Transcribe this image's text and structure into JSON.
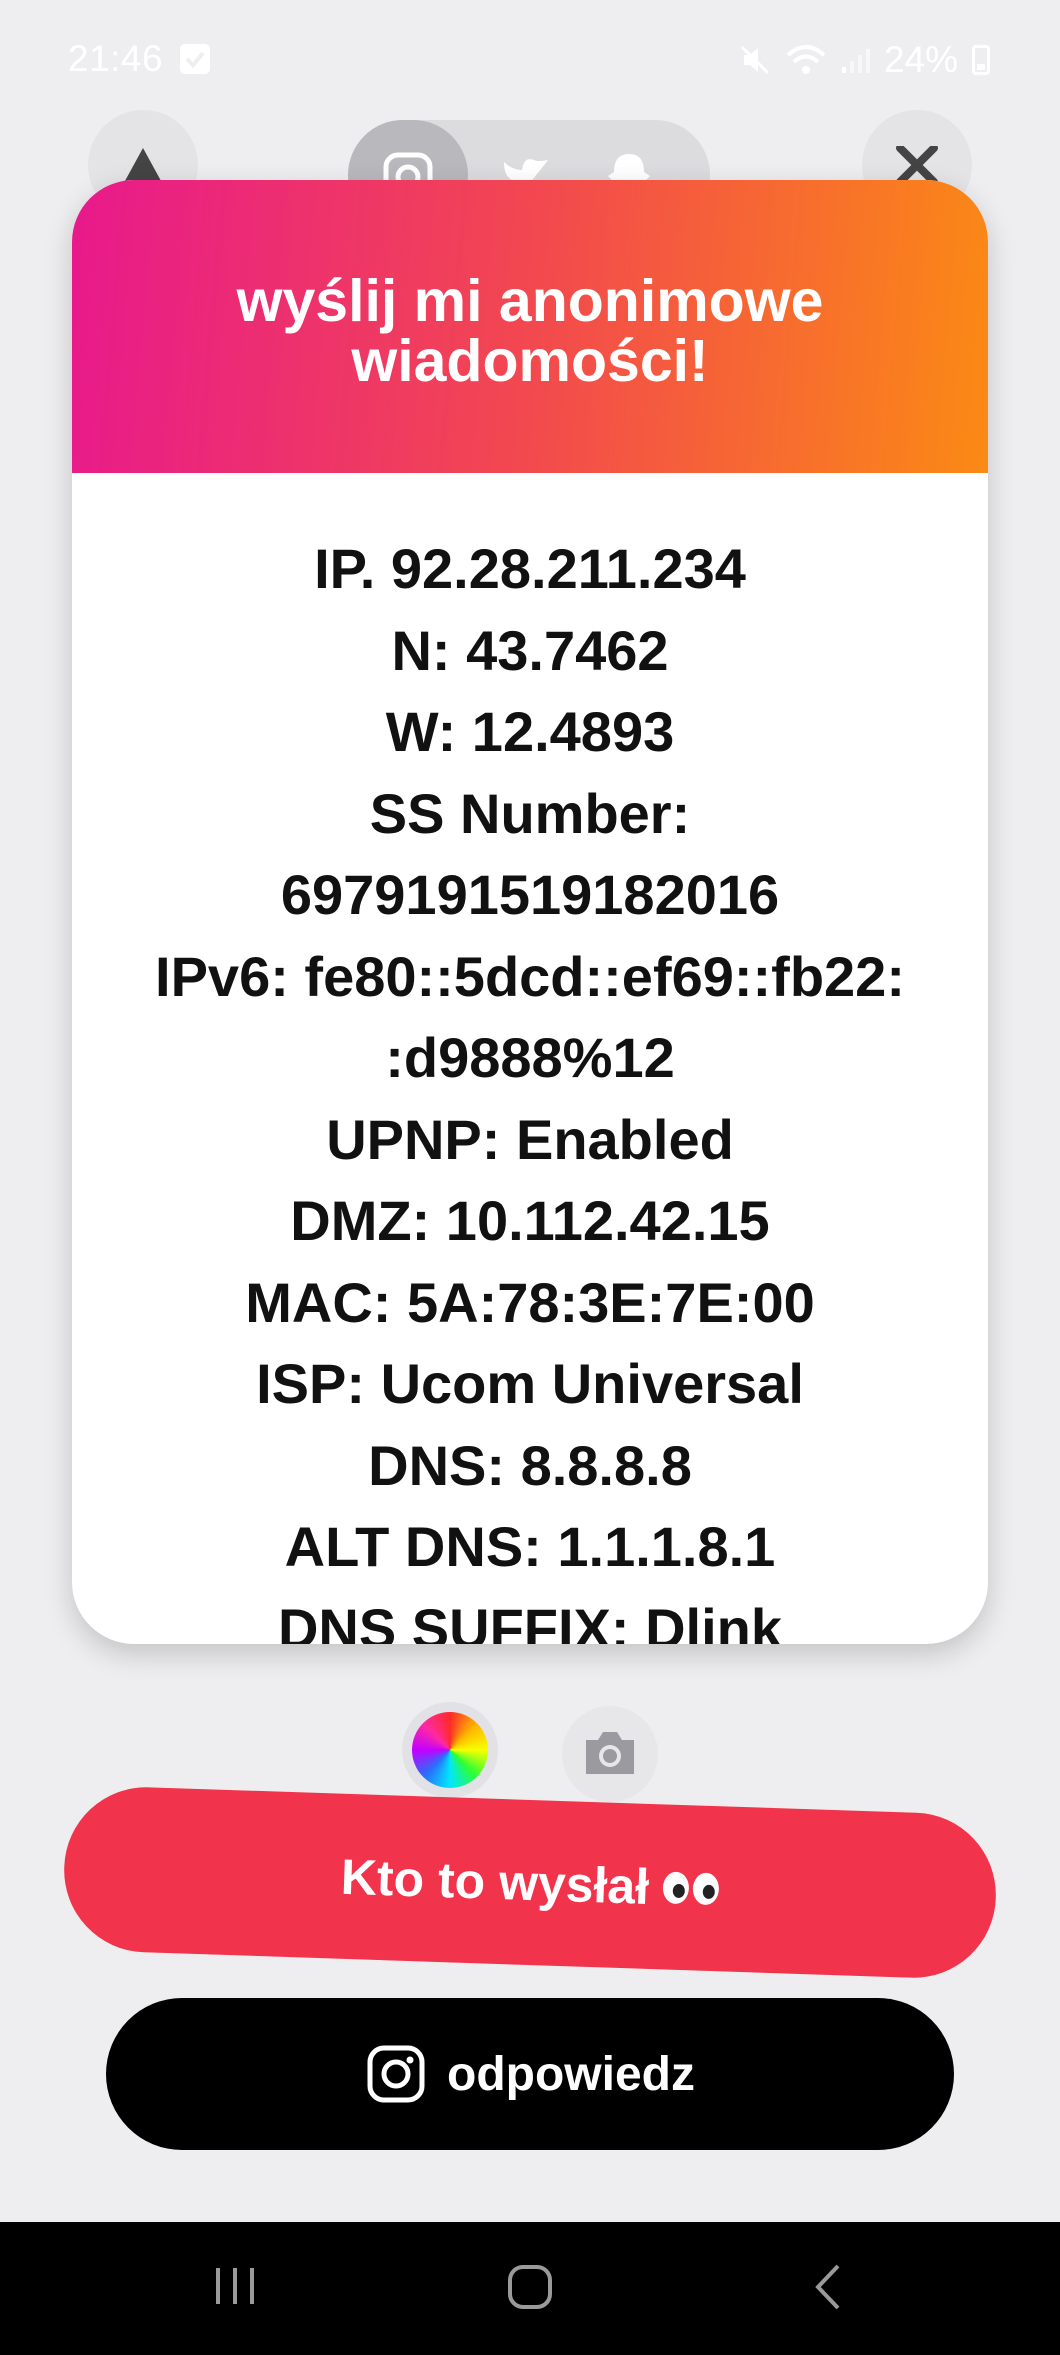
{
  "status_bar": {
    "time": "21:46",
    "battery": "24%"
  },
  "card": {
    "title": "wyślij mi anonimowe wiadomości!",
    "lines": [
      "IP. 92.28.211.234",
      "N: 43.7462",
      "W: 12.4893",
      "SS Number:",
      "6979191519182016",
      "IPv6: fe80::5dcd::ef69::fb22:",
      ":d9888%12",
      "UPNP: Enabled",
      "DMZ: 10.112.42.15",
      "MAC: 5A:78:3E:7E:00",
      "ISP: Ucom Universal",
      "DNS: 8.8.8.8",
      "ALT DNS: 1.1.1.8.1",
      "DNS SUFFIX: Dlink"
    ],
    "gradient_colors": [
      "#e8198c",
      "#f2484f",
      "#fb8a14"
    ]
  },
  "buttons": {
    "who_sent": "Kto to wysłał",
    "reply": "odpowiedz"
  },
  "colors": {
    "accent_red": "#f1344b",
    "reply_bg": "#000000"
  },
  "icons": {
    "share_options": [
      "instagram-icon",
      "twitter-icon",
      "snapchat-icon"
    ],
    "tools": [
      "color-wheel-icon",
      "camera-icon"
    ],
    "nav": [
      "recent-apps-icon",
      "home-icon",
      "back-icon"
    ]
  }
}
